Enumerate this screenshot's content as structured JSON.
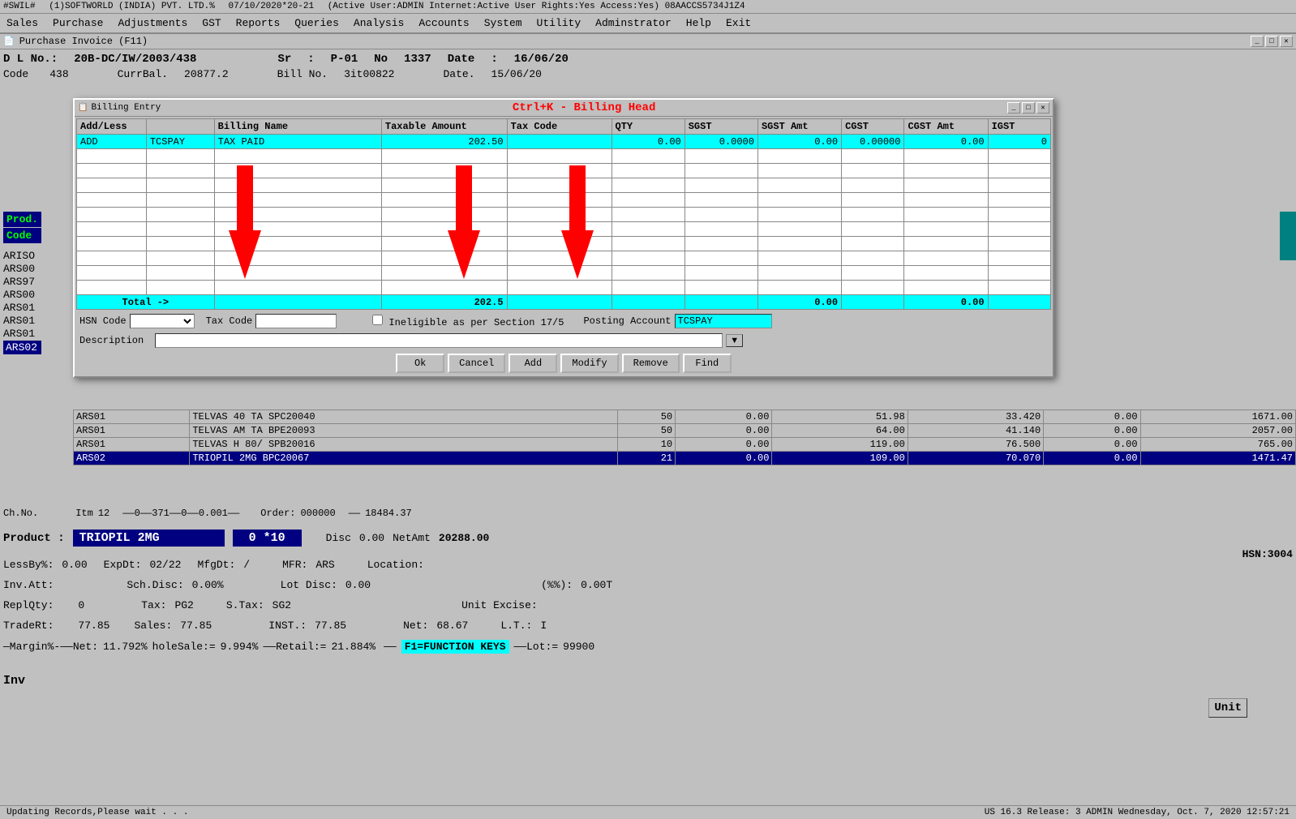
{
  "topbar": {
    "app_id": "#SWIL#",
    "company": "(1)SOFTWORLD (INDIA) PVT. LTD.%",
    "date": "07/10/2020*20-21",
    "active_info": "(Active User:ADMIN Internet:Active  User Rights:Yes Access:Yes) 08AACCS5734J1Z4"
  },
  "menu": {
    "items": [
      "Sales",
      "Purchase",
      "Adjustments",
      "GST",
      "Reports",
      "Queries",
      "Analysis",
      "Accounts",
      "System",
      "Utility",
      "Adminstrator",
      "Help",
      "Exit"
    ]
  },
  "window_title": "Purchase Invoice  (F11)",
  "purchase_form": {
    "dl_no_label": "D L No.:",
    "dl_no_value": "20B-DC/IW/2003/438",
    "sr_label": "Sr",
    "sr_value": "P-01",
    "no_label": "No",
    "no_value": "1337",
    "date_label": "Date",
    "date_value": "16/06/20",
    "code_label": "Code",
    "code_value": "438",
    "curr_bal_label": "CurrBal.",
    "curr_bal_value": "20877.2",
    "bill_no_label": "Bill No.",
    "bill_no_value": "3it00822",
    "date2_label": "Date.",
    "date2_value": "15/06/20"
  },
  "modal": {
    "small_title": "Billing Entry",
    "ctrl_k_title": "Ctrl+K - Billing Head",
    "columns": [
      "Add/Less",
      "",
      "Billing Name",
      "Taxable Amount",
      "Tax Code",
      "QTY",
      "SGST",
      "SGST Amt",
      "CGST",
      "CGST Amt",
      "IGST"
    ],
    "rows": [
      {
        "add_less": "ADD",
        "code": "TCSPAY",
        "billing_name": "TAX PAID",
        "taxable_amount": "202.50",
        "tax_code": "",
        "qty": "0.00",
        "sgst": "0.0000",
        "sgst_amt": "0.00",
        "cgst": "0.00000",
        "cgst_amt": "0.00",
        "igst": "0",
        "active": true
      }
    ],
    "empty_rows": 10,
    "total_row": {
      "label": "Total ->",
      "taxable_amount": "202.5",
      "sgst_amt": "0.00",
      "cgst_amt": "0.00"
    },
    "hsn_code_label": "HSN Code",
    "tax_code_label": "Tax Code",
    "ineligible_label": "Ineligible as per Section 17/5",
    "posting_account_label": "Posting Account",
    "posting_account_value": "TCSPAY",
    "description_label": "Description",
    "buttons": [
      "Ok",
      "Cancel",
      "Add",
      "Modify",
      "Remove",
      "Find"
    ]
  },
  "product_rows": [
    {
      "code": "ARS01",
      "name": "TELVAS 40 TA SPC20040",
      "qty": "50",
      "val1": "0.00",
      "val2": "51.98",
      "val3": "33.420",
      "val4": "0.00",
      "val5": "1671.00"
    },
    {
      "code": "ARS01",
      "name": "TELVAS AM TA BPE20093",
      "qty": "50",
      "val1": "0.00",
      "val2": "64.00",
      "val3": "41.140",
      "val4": "0.00",
      "val5": "2057.00"
    },
    {
      "code": "ARS01",
      "name": "TELVAS H 80/ SPB20016",
      "qty": "10",
      "val1": "0.00",
      "val2": "119.00",
      "val3": "76.500",
      "val4": "0.00",
      "val5": "765.00"
    },
    {
      "code": "ARS02",
      "name": "TRIOPIL 2MG  BPC20067",
      "qty": "21",
      "val1": "0.00",
      "val2": "109.00",
      "val3": "70.070",
      "val4": "0.00",
      "val5": "1471.47",
      "selected": true
    }
  ],
  "bottom_fields": {
    "ch_no_label": "Ch.No.",
    "itm_label": "Itm",
    "itm_value": "12",
    "order_label": "Order:",
    "order_value": "000000",
    "total_value": "18484.37",
    "product_label": "Product :",
    "product_value": "TRIOPIL 2MG",
    "disc_label": "Disc",
    "disc_value": "0.00",
    "net_amt_label": "NetAmt",
    "net_amt_value": "20288.00",
    "qty_value": "0 *10",
    "hsn_label": "HSN:3004",
    "less_by_label": "LessBy%:",
    "less_by_value": "0.00",
    "exp_dt_label": "ExpDt:",
    "exp_dt_value": "02/22",
    "mfg_dt_label": "MfgDt:",
    "mfg_dt_value": "/",
    "mfr_label": "MFR:",
    "mfr_value": "ARS",
    "location_label": "Location:",
    "inv_att_label": "Inv.Att:",
    "sch_disc_label": "Sch.Disc:",
    "sch_disc_value": "0.00%",
    "lot_disc_label": "Lot Disc:",
    "lot_disc_value": "0.00",
    "pct_label": "(%%):",
    "pct_value": "0.00T",
    "repl_qty_label": "ReplQty:",
    "repl_qty_value": "0",
    "tax_label": "Tax:",
    "tax_value": "PG2",
    "s_tax_label": "S.Tax:",
    "s_tax_value": "SG2",
    "unit_excise_label": "Unit Excise:",
    "trade_rt_label": "TradeRt:",
    "trade_rt_value": "77.85",
    "sales_label": "Sales:",
    "sales_value": "77.85",
    "inst_label": "INST.:",
    "inst_value": "77.85",
    "net_label": "Net:",
    "net_value": "68.67",
    "lt_label": "L.T.:",
    "lt_value": "I",
    "margin_label": "Margin%-",
    "net_pct_label": "Net:",
    "net_pct_value": "11.792%",
    "wholesale_label": "holeSale:=",
    "wholesale_value": "9.994%",
    "retail_label": "Retail:=",
    "retail_value": "21.884%",
    "f1_label": "F1=FUNCTION KEYS",
    "lot_label": "Lot:=",
    "lot_value": "99900"
  },
  "status_bar": {
    "left": "Updating Records,Please wait . . .",
    "right": "US 16.3 Release: 3 ADMIN Wednesday, Oct. 7, 2020  12:57:21"
  },
  "left_sidebar_items": [
    "ARISO",
    "ARS00",
    "ARS97",
    "ARS00",
    "ARS01",
    "ARS01",
    "ARS01",
    "ARS02"
  ],
  "left_product_codes": [
    "Prod.",
    "Code"
  ],
  "inv_label": "Inv"
}
